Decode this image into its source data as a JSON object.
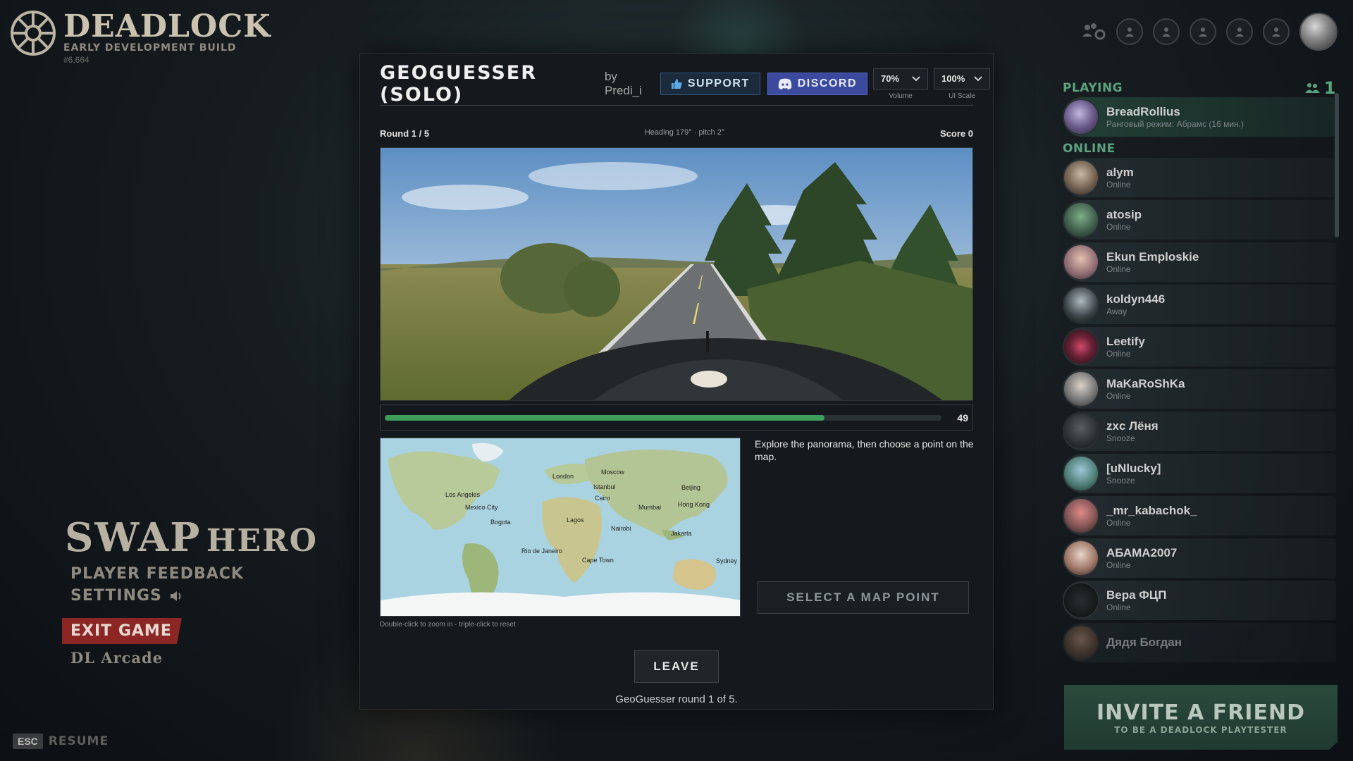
{
  "logo": {
    "title": "DEADLOCK",
    "subtitle": "EARLY DEVELOPMENT BUILD",
    "build": "#6,664"
  },
  "left_menu": {
    "swap_big": "SWAP",
    "swap_small": "HERO",
    "feedback": "PLAYER FEEDBACK",
    "settings": "SETTINGS",
    "exit": "EXIT GAME",
    "arcade": "DL Arcade",
    "esc_key": "ESC",
    "resume": "RESUME"
  },
  "modal": {
    "title": "GEOGUESSER (SOLO)",
    "by": "by Predi_i",
    "support_label": "SUPPORT",
    "discord_label": "DISCORD",
    "volume_value": "70%",
    "volume_label": "Volume",
    "scale_value": "100%",
    "scale_label": "UI Scale",
    "round": "Round 1 / 5",
    "heading": "Heading 179° · pitch 2°",
    "score": "Score 0",
    "timer_value": 49,
    "timer_fraction": 0.79,
    "map_hint": "Double-click to zoom in · triple-click to reset",
    "explore": "Explore the panorama, then choose a point on the map.",
    "select_button": "SELECT A MAP POINT",
    "leave_button": "LEAVE",
    "footer": "GeoGuesser round 1 of 5.",
    "map_labels": [
      "London",
      "Moscow",
      "Istanbul",
      "Beijing",
      "Los Angeles",
      "Cairo",
      "Mexico City",
      "Mumbai",
      "Hong Kong",
      "Bogota",
      "Lagos",
      "Nairobi",
      "Jakarta",
      "Rio de Janeiro",
      "Cape Town",
      "Sydney"
    ]
  },
  "friends": {
    "playing_label": "PLAYING",
    "playing_count": "1",
    "online_label": "ONLINE",
    "playing": [
      {
        "name": "BreadRollius",
        "status": "Ранговый режим: Абрамс (16 мин.)"
      }
    ],
    "online": [
      {
        "name": "alym",
        "status": "Online"
      },
      {
        "name": "atosip",
        "status": "Online"
      },
      {
        "name": "Ekun Emploskie",
        "status": "Online"
      },
      {
        "name": "koldyn446",
        "status": "Away"
      },
      {
        "name": "Leetify",
        "status": "Online"
      },
      {
        "name": "MaKaRoShKa",
        "status": "Online"
      },
      {
        "name": "zxc Лёня",
        "status": "Snooze"
      },
      {
        "name": "[uNlucky]",
        "status": "Snooze"
      },
      {
        "name": "_mr_kabachok_",
        "status": "Online"
      },
      {
        "name": "АБАМА2007",
        "status": "Online"
      },
      {
        "name": "Вера ФЦП",
        "status": "Online"
      },
      {
        "name": "Дядя Богдан",
        "status": ""
      }
    ]
  },
  "invite": {
    "title": "INVITE A FRIEND",
    "subtitle": "TO BE A DEADLOCK PLAYTESTER"
  }
}
